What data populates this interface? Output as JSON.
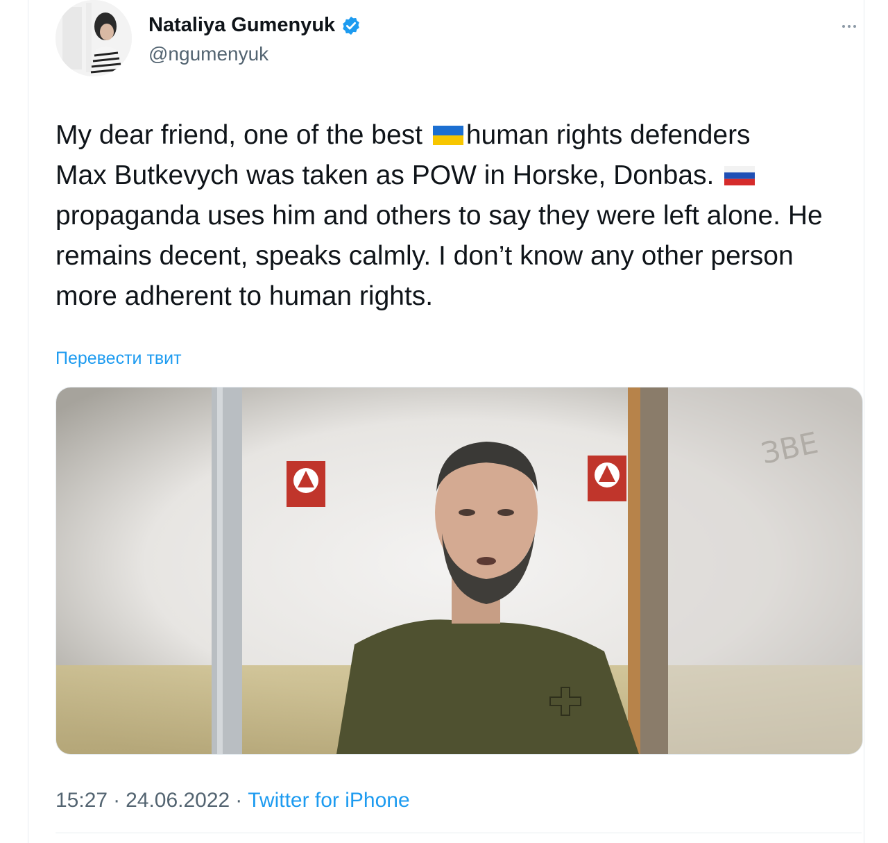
{
  "author": {
    "name": "Nataliya Gumenyuk",
    "handle": "@ngumenyuk",
    "verified": true
  },
  "tweet": {
    "line1_before_flag": "My dear friend, one of the best ",
    "line1_after_flag": "human rights defenders",
    "line2_before_flag": "Max Butkevych was taken as POW in Horske, Donbas. ",
    "rest": "propaganda uses him and others to say they were left alone. He remains decent, speaks calmly. I don’t know any other person more adherent to human rights."
  },
  "translate_label": "Перевести твит",
  "meta": {
    "time": "15:27",
    "date": "24.06.2022",
    "separator": "·",
    "source": "Twitter for iPhone"
  },
  "colors": {
    "accent": "#1d9bf0",
    "text": "#0f1419",
    "secondary": "#536471"
  },
  "icons": {
    "verified": "verified-badge-icon",
    "more": "more-options-icon",
    "flag_ua": "ukraine-flag-icon",
    "flag_ru": "russia-flag-icon"
  }
}
